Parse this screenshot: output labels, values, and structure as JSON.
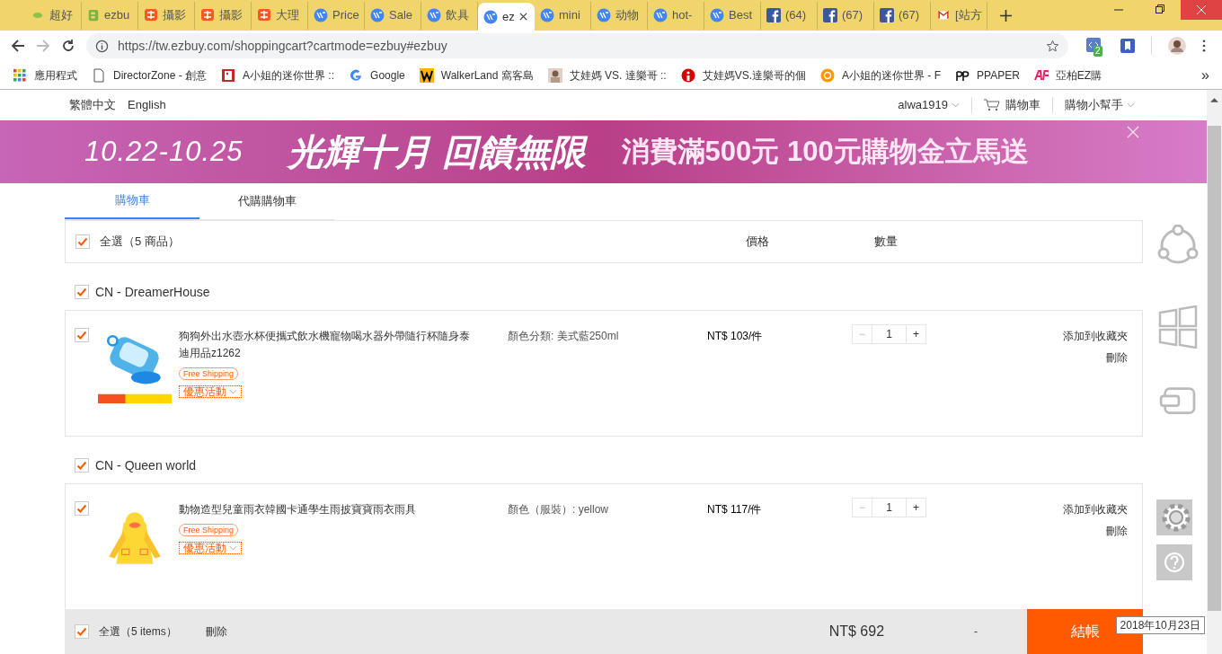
{
  "browser": {
    "tabs": [
      {
        "label": "超好",
        "kind": "leaf",
        "selected": false
      },
      {
        "label": "ezbu",
        "kind": "letter-b",
        "selected": false
      },
      {
        "label": "攝影",
        "kind": "taobao",
        "selected": false
      },
      {
        "label": "攝影",
        "kind": "taobao",
        "selected": false
      },
      {
        "label": "大理",
        "kind": "taobao",
        "selected": false
      },
      {
        "label": "Price",
        "kind": "ezbuy",
        "selected": false
      },
      {
        "label": "Sale",
        "kind": "ezbuy",
        "selected": false
      },
      {
        "label": "飲具",
        "kind": "ezbuy",
        "selected": false
      },
      {
        "label": "ez",
        "kind": "ezbuy",
        "selected": true
      },
      {
        "label": "mini",
        "kind": "ezbuy",
        "selected": false
      },
      {
        "label": "动物",
        "kind": "ezbuy",
        "selected": false
      },
      {
        "label": "hot-",
        "kind": "ezbuy",
        "selected": false
      },
      {
        "label": "Best",
        "kind": "ezbuy",
        "selected": false
      },
      {
        "label": "(64)",
        "kind": "facebook",
        "selected": false
      },
      {
        "label": "(67)",
        "kind": "facebook",
        "selected": false
      },
      {
        "label": "(67)",
        "kind": "facebook",
        "selected": false
      },
      {
        "label": "[站方",
        "kind": "gmail",
        "selected": false
      }
    ],
    "address": "https://tw.ezbuy.com/shoppingcart?cartmode=ezbuy#ezbuy",
    "extension_badge": "2",
    "bookmarks": [
      {
        "label": "應用程式",
        "kind": "apps"
      },
      {
        "label": "DirectorZone - 創意",
        "kind": "page"
      },
      {
        "label": "A小姐的迷你世界 ::",
        "kind": "card"
      },
      {
        "label": "Google",
        "kind": "google"
      },
      {
        "label": "WalkerLand 窩客島",
        "kind": "walker"
      },
      {
        "label": "艾娃媽 VS. 達樂哥 ::",
        "kind": "avatar"
      },
      {
        "label": "艾娃媽VS.達樂哥的個",
        "kind": "pin"
      },
      {
        "label": "A小姐的迷你世界 - F",
        "kind": "fc"
      },
      {
        "label": "PPAPER",
        "kind": "pp"
      },
      {
        "label": "亞柏EZ購",
        "kind": "ap"
      }
    ],
    "bookmarks_more": "»"
  },
  "header": {
    "languages": [
      "繁體中文",
      "English"
    ],
    "user": "alwa1919",
    "cart": "購物車",
    "helper": "購物小幫手"
  },
  "banner": {
    "dates": "10.22-10.25",
    "headline": "光輝十月 回饋無限",
    "offer": "消費滿500元  100元購物金立馬送"
  },
  "cart_tabs": [
    {
      "label": "購物車",
      "selected": true
    },
    {
      "label": "代購購物車",
      "selected": false
    }
  ],
  "select_all": {
    "label": "全選（5 商品）",
    "checked": true
  },
  "columns": [
    "價格",
    "數量"
  ],
  "shops": [
    {
      "name": "CN - DreamerHouse",
      "checked": true,
      "items": [
        {
          "title": "狗狗外出水壺水杯便攜式飲水機寵物喝水器外帶隨行杯隨身泰迪用品z1262",
          "checked": true,
          "badge": "Free Shipping",
          "promo": "優惠活動",
          "variant": "顏色分類: 美式藍250ml",
          "price": "NT$ 103/件",
          "minus": "−",
          "decrease_disabled": true,
          "quantity": "1",
          "plus": "+",
          "actions": [
            "添加到收藏夾",
            "刪除"
          ]
        }
      ]
    },
    {
      "name": "CN - Queen world",
      "checked": true,
      "items": [
        {
          "title": "動物造型兒童雨衣韓國卡通學生雨披寶寶雨衣雨具",
          "checked": true,
          "badge": "Free Shipping",
          "promo": "優惠活動",
          "variant": "顏色（服裝）: yellow",
          "price": "NT$ 117/件",
          "minus": "−",
          "decrease_disabled": true,
          "quantity": "1",
          "plus": "+",
          "actions": [
            "添加到收藏夾",
            "刪除"
          ]
        }
      ]
    }
  ],
  "footer": {
    "select_all": {
      "label": "全選（5 items）",
      "checked": true
    },
    "delete": "刪除",
    "total": "NT$ 692",
    "shipping": "-",
    "checkout": "結帳"
  },
  "clock_tooltip": "2018年10月23日"
}
